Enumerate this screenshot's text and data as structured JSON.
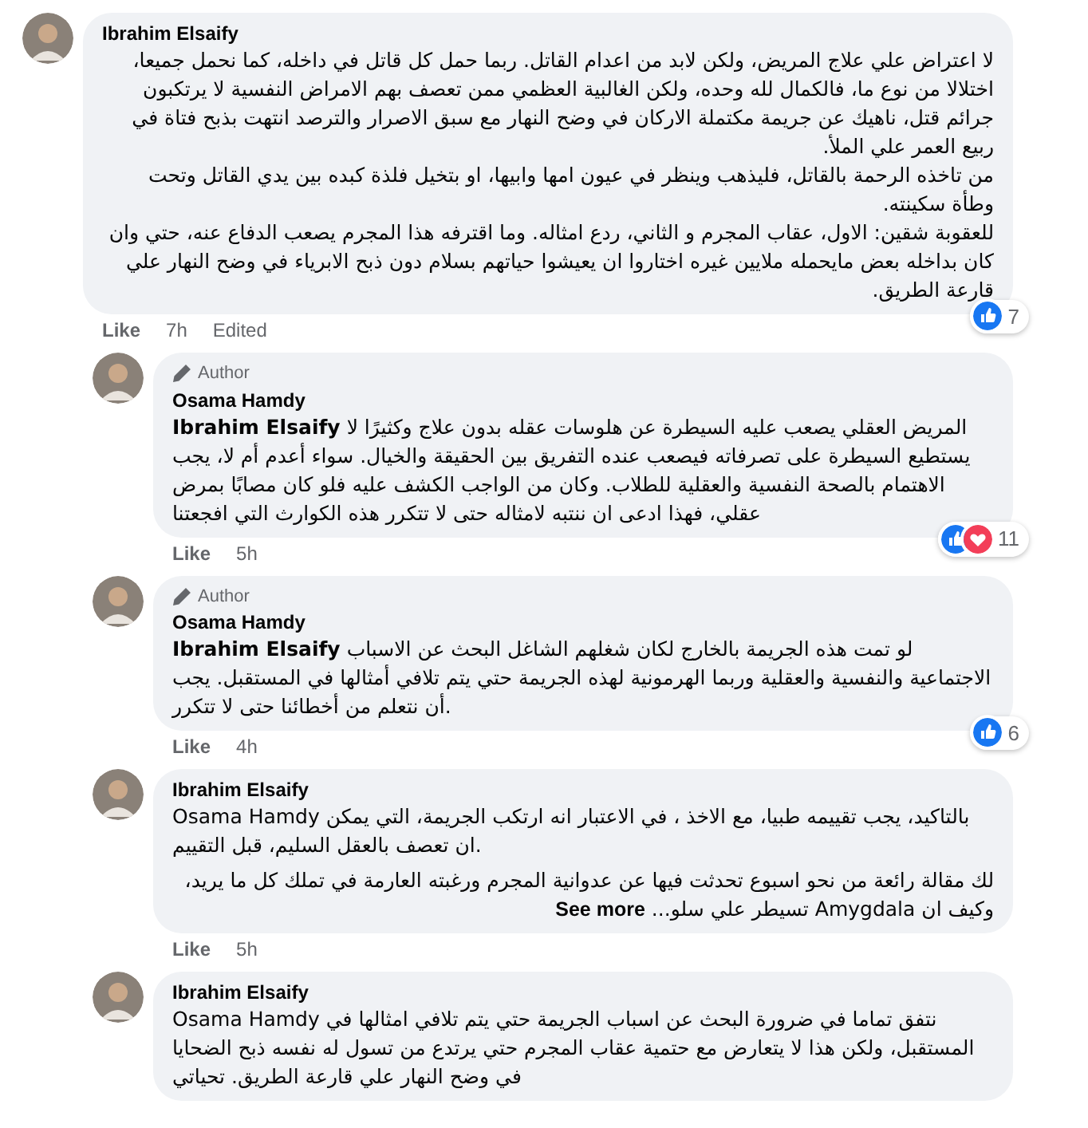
{
  "comments": [
    {
      "kind": "comment",
      "author": "Ibrahim Elsaify",
      "paragraphs": [
        "لا اعتراض علي علاج المريض، ولكن لابد من اعدام القاتل. ربما حمل كل قاتل في داخله، كما نحمل جميعا، اختلالا من نوع ما، فالكمال لله وحده، ولكن الغالبية العظمي ممن تعصف بهم الامراض النفسية لا يرتكبون جرائم قتل، ناهيك عن جريمة مكتملة الاركان في وضح النهار مع سبق الاصرار والترصد انتهت بذبح فتاة في ربيع العمر علي الملأ.\nمن تاخذه الرحمة بالقاتل، فليذهب وينظر في عيون امها وابيها، او بتخيل فلذة كبده بين يدي القاتل وتحت وطأة سكينته.\nللعقوبة شقين: الاول، عقاب المجرم و الثاني، ردع امثاله. وما اقترفه هذا المجرم يصعب الدفاع عنه، حتي وان كان بداخله بعض مايحمله ملايين غيره اختاروا ان يعيشوا حياتهم بسلام دون ذبح الابرياء في وضح النهار علي قارعة الطريق."
      ],
      "like": "Like",
      "time": "7h",
      "edited": "Edited",
      "reactions": {
        "count": "7",
        "like": true,
        "love": false
      }
    },
    {
      "kind": "reply",
      "author_badge": "Author",
      "author": "Osama Hamdy",
      "paragraphs": [
        "**Ibrahim Elsaify** المريض العقلي يصعب عليه السيطرة عن هلوسات عقله بدون علاج وكثيرًا لا يستطيع السيطرة على تصرفاته فيصعب عنده التفريق بين الحقيقة والخيال. سواء أعدم أم لا، يجب الاهتمام بالصحة النفسية والعقلية للطلاب. وكان من الواجب الكشف عليه فلو كان مصابًا بمرض عقلي، فهذا ادعى ان ننتبه لامثاله حتى لا تتكرر هذه الكوارث التي افجعتنا"
      ],
      "like": "Like",
      "time": "5h",
      "reactions": {
        "count": "11",
        "like": true,
        "love": true
      }
    },
    {
      "kind": "reply",
      "author_badge": "Author",
      "author": "Osama Hamdy",
      "paragraphs": [
        "**Ibrahim Elsaify** لو تمت هذه الجريمة بالخارج لكان شغلهم الشاغل البحث عن الاسباب الاجتماعية والنفسية والعقلية وربما الهرمونية لهذه الجريمة حتي يتم تلافي أمثالها في المستقبل. يجب أن نتعلم من أخطائنا حتى لا تتكرر."
      ],
      "like": "Like",
      "time": "4h",
      "reactions": {
        "count": "6",
        "like": true,
        "love": false
      }
    },
    {
      "kind": "reply",
      "author": "Ibrahim Elsaify",
      "paragraphs": [
        "Osama Hamdy بالتاكيد، يجب تقييمه طبيا، مع الاخذ ، في الاعتبار انه ارتكب الجريمة، التي يمكن ان تعصف بالعقل السليم، قبل التقييم.",
        "لك مقالة رائعة من نحو اسبوع تحدثت فيها عن عدوانية المجرم ورغبته العارمة في تملك كل ما يريد، وكيف ان Amygdala تسيطر علي سلو..."
      ],
      "see_more": "See more",
      "like": "Like",
      "time": "5h"
    },
    {
      "kind": "reply",
      "author": "Ibrahim Elsaify",
      "paragraphs": [
        "Osama Hamdy نتفق تماما في ضرورة البحث عن اسباب الجريمة حتي يتم تلافي امثالها في المستقبل، ولكن هذا لا يتعارض مع حتمية عقاب المجرم حتي يرتدع من تسول له نفسه ذبح الضحايا في وضح النهار علي قارعة الطريق. تحياتي"
      ]
    }
  ]
}
